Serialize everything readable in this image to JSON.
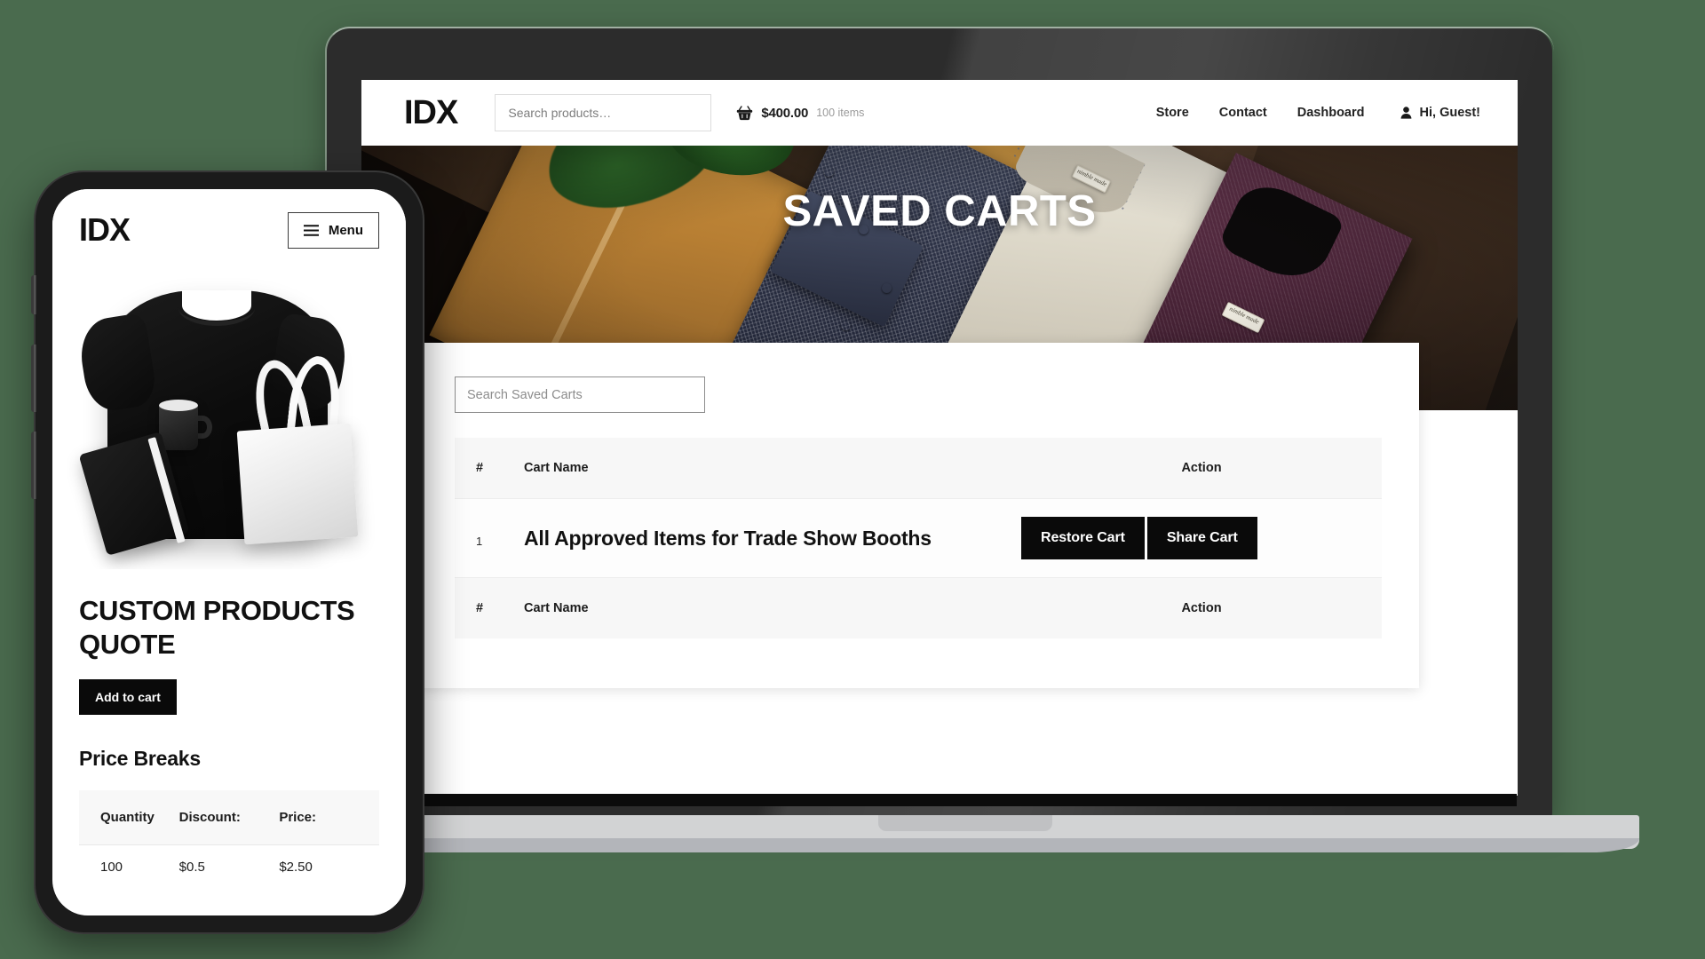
{
  "desktop": {
    "header": {
      "logo": "IDX",
      "search_placeholder": "Search products…",
      "cart_total": "$400.00",
      "cart_items": "100 items",
      "nav": [
        {
          "label": "Store"
        },
        {
          "label": "Contact"
        },
        {
          "label": "Dashboard"
        }
      ],
      "user_greeting": "Hi, Guest!"
    },
    "hero": {
      "title": "SAVED CARTS",
      "shirt_tag_text": "nimble made"
    },
    "content": {
      "search_placeholder": "Search Saved Carts",
      "table": {
        "headers": [
          "#",
          "Cart Name",
          "Action"
        ],
        "footers": [
          "#",
          "Cart Name",
          "Action"
        ],
        "rows": [
          {
            "num": "1",
            "name": "All Approved Items for Trade Show Booths",
            "restore_label": "Restore Cart",
            "share_label": "Share Cart"
          }
        ]
      }
    }
  },
  "mobile": {
    "logo": "IDX",
    "menu_label": "Menu",
    "product_title": "CUSTOM PRODUCTS QUOTE",
    "add_to_cart_label": "Add to cart",
    "price_breaks_title": "Price Breaks",
    "price_table": {
      "headers": [
        "Quantity",
        "Discount:",
        "Price:"
      ],
      "rows": [
        [
          "100",
          "$0.5",
          "$2.50"
        ]
      ]
    }
  },
  "colors": {
    "background": "#4a6b4e",
    "button_dark": "#0a0a0a",
    "text_primary": "#111111",
    "table_header_bg": "#f7f7f7"
  }
}
